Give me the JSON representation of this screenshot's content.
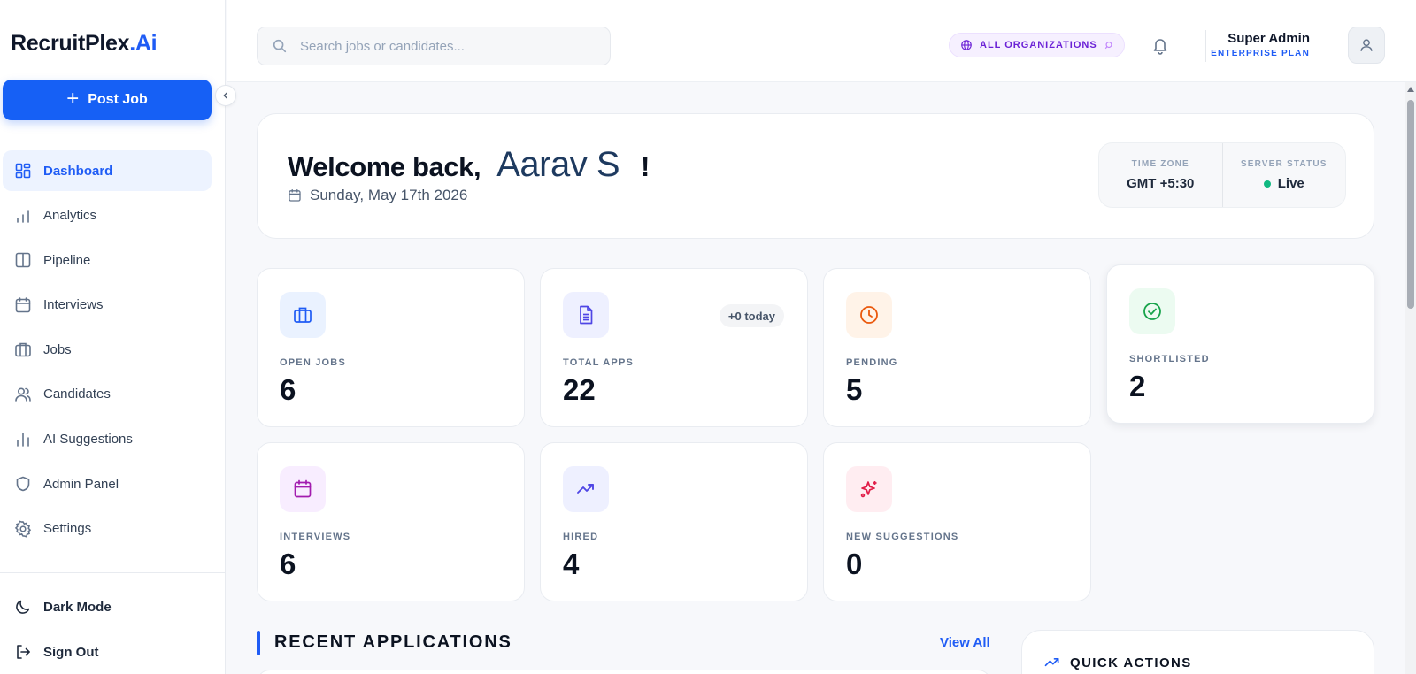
{
  "brand": {
    "name": "RecruitPlex",
    "suffix": ".Ai"
  },
  "sidebar": {
    "post_job_label": "Post Job",
    "items": [
      {
        "label": "Dashboard",
        "icon": "dashboard-icon",
        "active": true
      },
      {
        "label": "Analytics",
        "icon": "analytics-icon"
      },
      {
        "label": "Pipeline",
        "icon": "pipeline-icon"
      },
      {
        "label": "Interviews",
        "icon": "calendar-icon"
      },
      {
        "label": "Jobs",
        "icon": "briefcase-icon"
      },
      {
        "label": "Candidates",
        "icon": "users-icon"
      },
      {
        "label": "AI Suggestions",
        "icon": "bar-chart-icon"
      },
      {
        "label": "Admin Panel",
        "icon": "shield-icon"
      },
      {
        "label": "Settings",
        "icon": "gear-icon"
      }
    ],
    "dark_mode_label": "Dark Mode",
    "sign_out_label": "Sign Out"
  },
  "header": {
    "search_placeholder": "Search jobs or candidates...",
    "org_label": "ALL ORGANIZATIONS",
    "user_name": "Super Admin",
    "user_plan": "ENTERPRISE PLAN"
  },
  "welcome": {
    "greeting": "Welcome back,",
    "name": "Aarav S",
    "exclaim": "!",
    "date": "Sunday, May 17th 2026",
    "timezone_label": "TIME ZONE",
    "timezone_value": "GMT +5:30",
    "server_label": "SERVER STATUS",
    "server_value": "Live"
  },
  "stats": {
    "open_jobs": {
      "label": "OPEN JOBS",
      "value": "6"
    },
    "total_apps": {
      "label": "TOTAL APPS",
      "value": "22",
      "chip": "+0 today"
    },
    "pending": {
      "label": "PENDING",
      "value": "5"
    },
    "shortlisted": {
      "label": "SHORTLISTED",
      "value": "2"
    },
    "interviews": {
      "label": "INTERVIEWS",
      "value": "6"
    },
    "hired": {
      "label": "HIRED",
      "value": "4"
    },
    "new_suggestions": {
      "label": "NEW SUGGESTIONS",
      "value": "0"
    }
  },
  "recent": {
    "title": "RECENT APPLICATIONS",
    "view_all": "View All"
  },
  "quick_actions": {
    "title": "QUICK ACTIONS"
  },
  "colors": {
    "accent": "#1f5cf5",
    "live": "#10b981",
    "org": "#6b21d6"
  }
}
